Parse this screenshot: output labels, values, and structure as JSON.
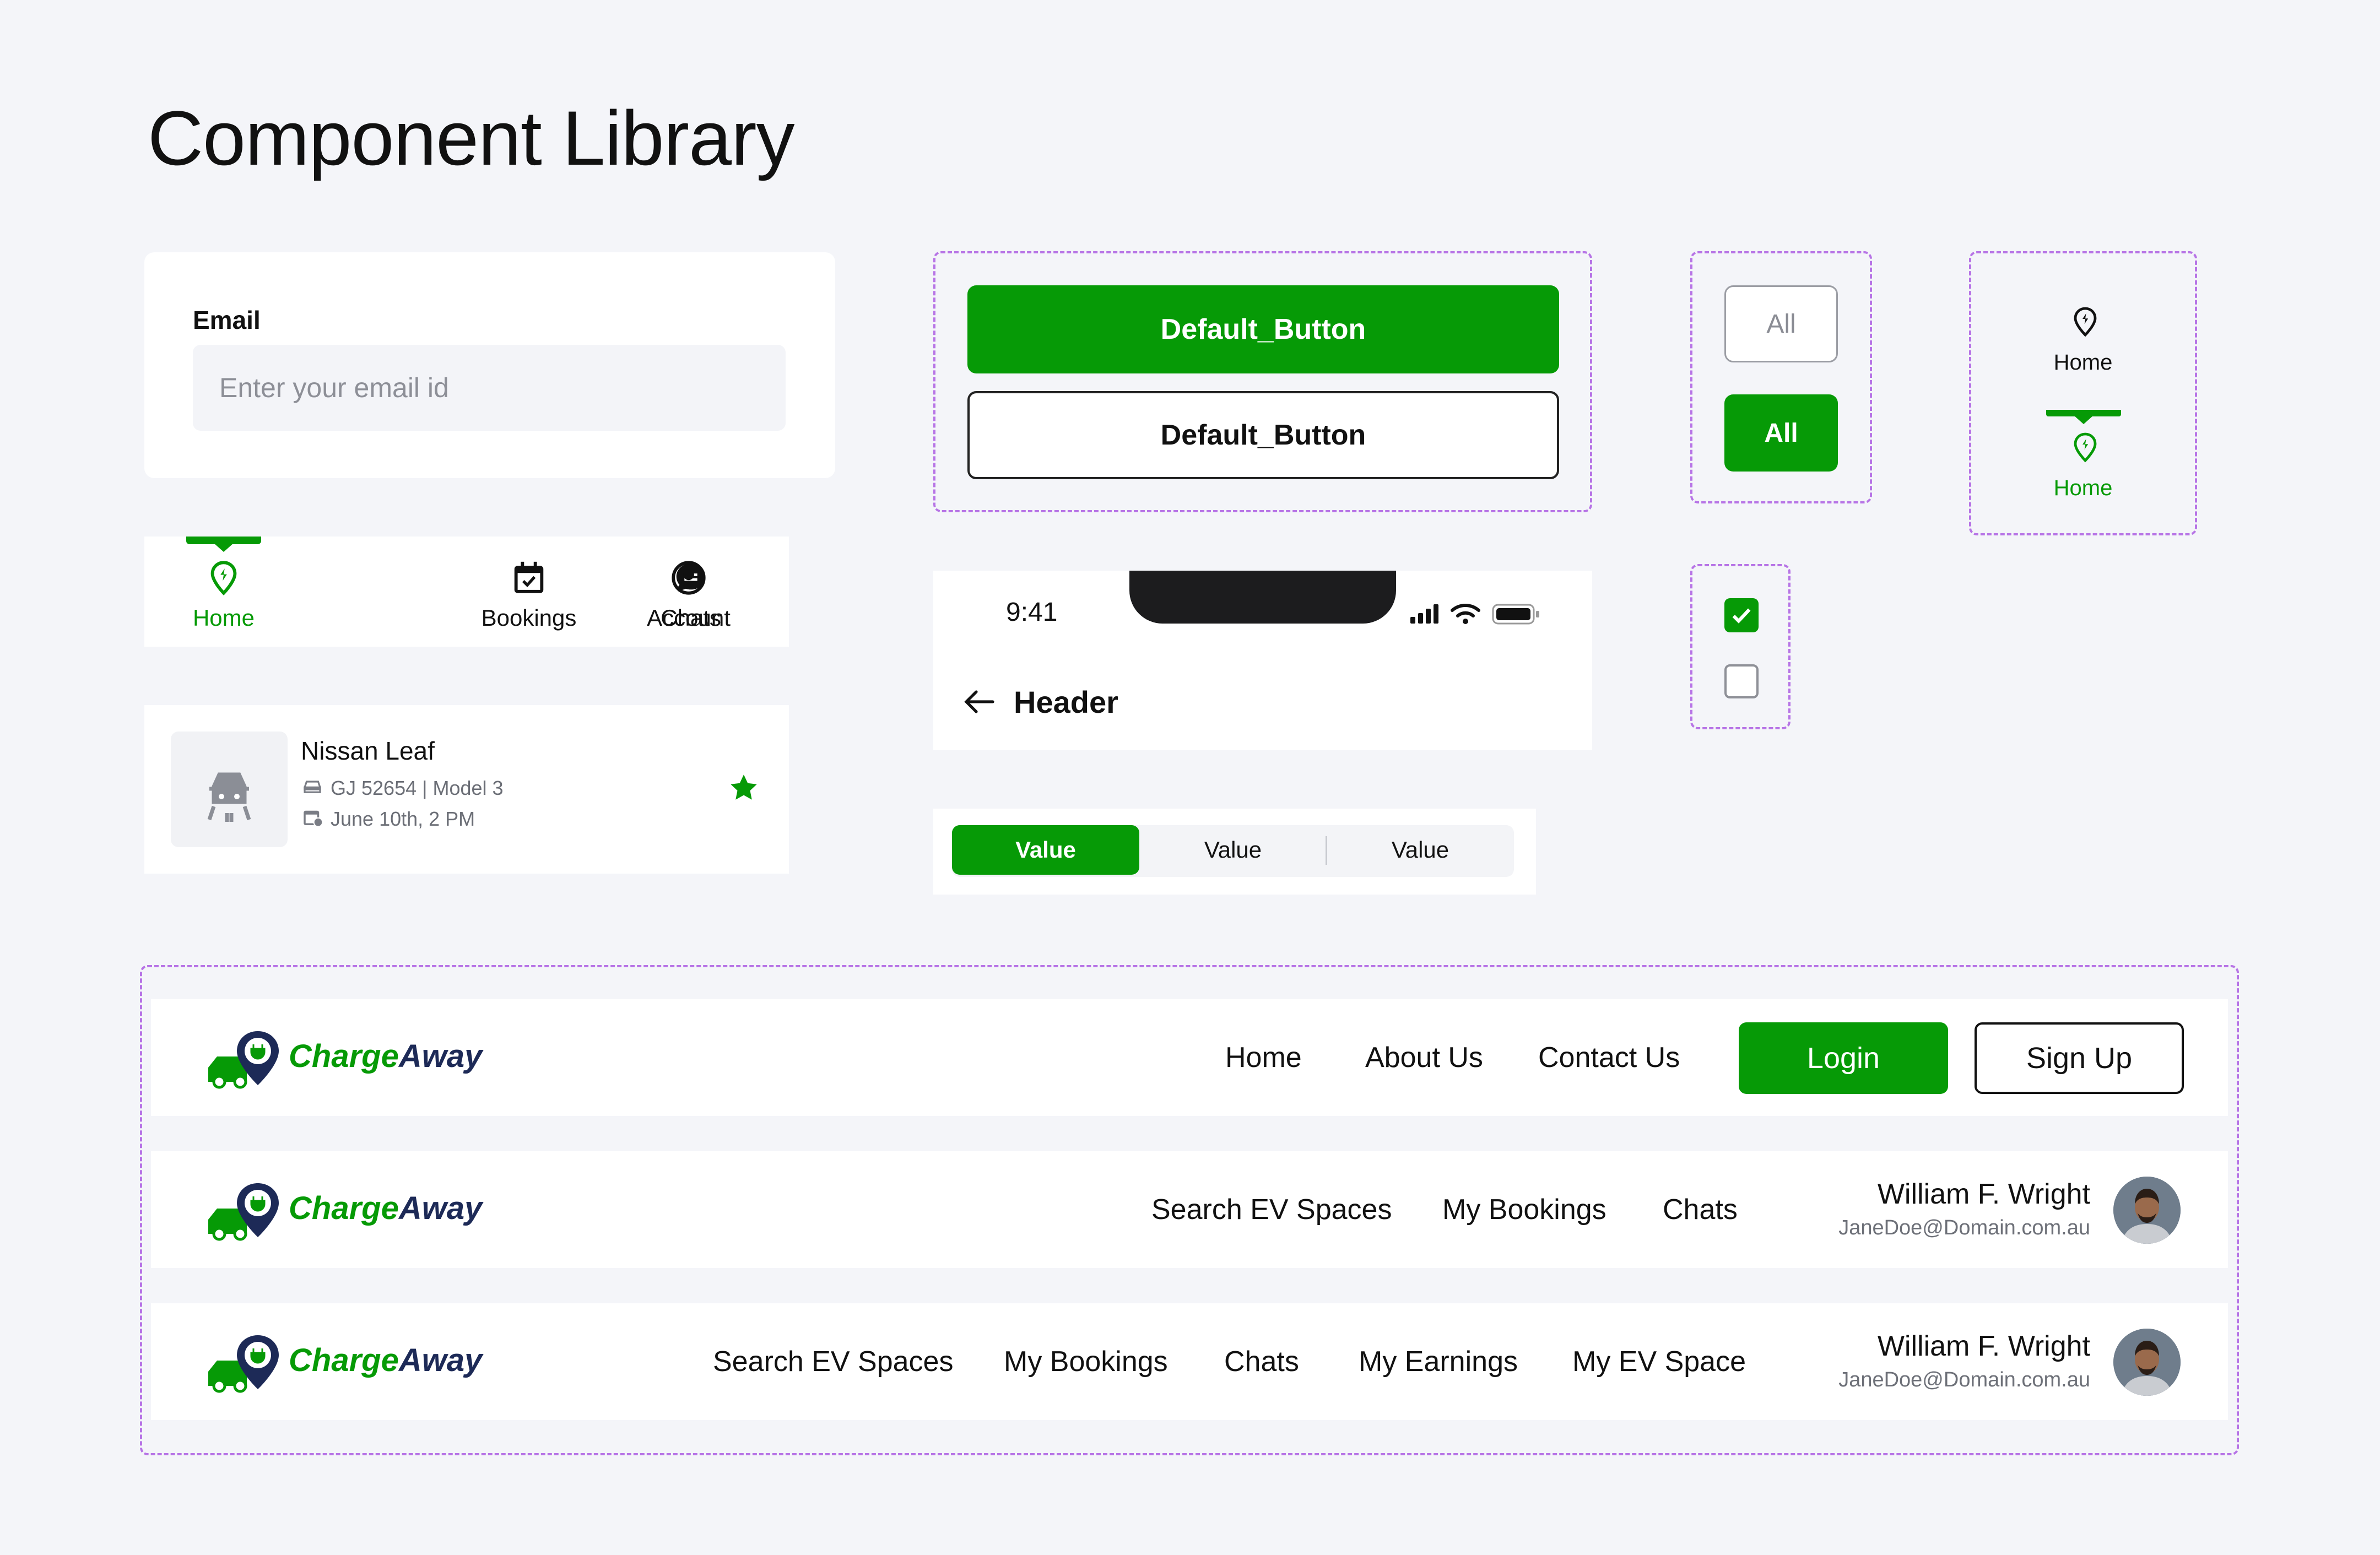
{
  "page": {
    "title": "Component Library"
  },
  "email_field": {
    "label": "Email",
    "placeholder": "Enter your email id"
  },
  "bottom_nav": {
    "items": [
      {
        "label": "Home",
        "icon": "location-pin-icon",
        "active": true
      },
      {
        "label": "Bookings",
        "icon": "calendar-check-icon",
        "active": false
      },
      {
        "label": "Chats",
        "icon": "chat-bubble-icon",
        "active": false
      },
      {
        "label": "Account",
        "icon": "user-circle-icon",
        "active": false
      }
    ]
  },
  "booking_card": {
    "name": "Nissan Leaf",
    "plate_model": "GJ 52654 | Model 3",
    "date": "June 10th, 2 PM",
    "favorite": true
  },
  "buttons": {
    "primary_label": "Default_Button",
    "secondary_label": "Default_Button"
  },
  "chips": {
    "outline_label": "All",
    "filled_label": "All"
  },
  "nav_tab": {
    "default_label": "Home",
    "active_label": "Home"
  },
  "checkboxes": {
    "first_checked": true,
    "second_checked": false
  },
  "phone_header": {
    "time": "9:41",
    "title": "Header"
  },
  "segmented_control": {
    "segments": [
      "Value",
      "Value",
      "Value"
    ],
    "selected_index": 0
  },
  "headers": {
    "logo_text_green": "Charge",
    "logo_text_navy": "Away",
    "public_menu": [
      "Home",
      "About Us",
      "Contact Us"
    ],
    "login_label": "Login",
    "signup_label": "Sign Up",
    "user_menu": [
      "Search EV Spaces",
      "My Bookings",
      "Chats"
    ],
    "host_menu": [
      "Search EV Spaces",
      "My Bookings",
      "Chats",
      "My Earnings",
      "My EV Space"
    ],
    "user": {
      "name": "William F. Wright",
      "email": "JaneDoe@Domain.com.au"
    }
  },
  "colors": {
    "brand_green": "#069a06",
    "brand_navy": "#1d2a57",
    "dashed_border": "#b774e6",
    "background": "#f4f5f9"
  }
}
